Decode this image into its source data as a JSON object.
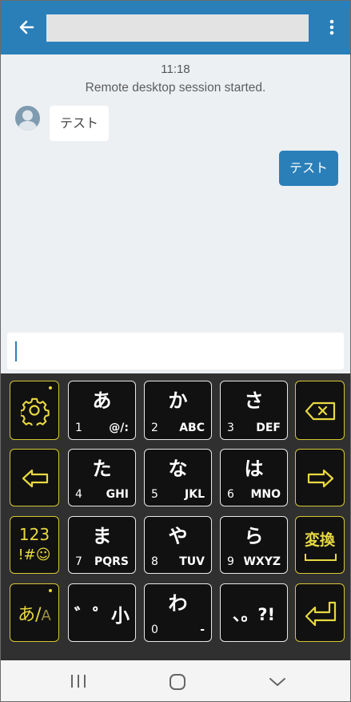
{
  "header": {
    "back_icon": "arrow-left-icon",
    "more_icon": "more-vertical-icon",
    "colors": {
      "bar": "#2a7fb9"
    }
  },
  "chat": {
    "time": "11:18",
    "system_message": "Remote desktop session started.",
    "incoming": {
      "text": "テスト"
    },
    "outgoing": {
      "text": "テスト"
    }
  },
  "keyboard": {
    "settings_icon": "gear-icon",
    "backspace_icon": "backspace-icon",
    "left_icon": "arrow-left-outline-icon",
    "right_icon": "arrow-right-outline-icon",
    "enter_icon": "enter-icon",
    "keys": {
      "a": {
        "kana": "あ",
        "num": "1",
        "alpha": "@/:"
      },
      "ka": {
        "kana": "か",
        "num": "2",
        "alpha": "ABC"
      },
      "sa": {
        "kana": "さ",
        "num": "3",
        "alpha": "DEF"
      },
      "ta": {
        "kana": "た",
        "num": "4",
        "alpha": "GHI"
      },
      "na": {
        "kana": "な",
        "num": "5",
        "alpha": "JKL"
      },
      "ha": {
        "kana": "は",
        "num": "6",
        "alpha": "MNO"
      },
      "ma": {
        "kana": "ま",
        "num": "7",
        "alpha": "PQRS"
      },
      "ya": {
        "kana": "や",
        "num": "8",
        "alpha": "TUV"
      },
      "ra": {
        "kana": "ら",
        "num": "9",
        "alpha": "WXYZ"
      },
      "dakuten": {
        "label": "゛゜小"
      },
      "wa": {
        "kana": "わ",
        "num": "0",
        "alpha": "-"
      },
      "punct": {
        "label": "、。?!"
      }
    },
    "symbols_key": {
      "line1": "123",
      "line2": "!#☺"
    },
    "convert_key": {
      "label": "変換"
    },
    "mode_key": {
      "label_a": "あ",
      "label_sep": "/",
      "label_b": "A"
    },
    "colors": {
      "accent": "#e8d940",
      "key_bg": "#111111",
      "keyboard_bg": "#303030"
    }
  },
  "navbar": {
    "recents_icon": "recents-icon",
    "home_icon": "home-icon",
    "back_icon": "chevron-down-icon"
  }
}
